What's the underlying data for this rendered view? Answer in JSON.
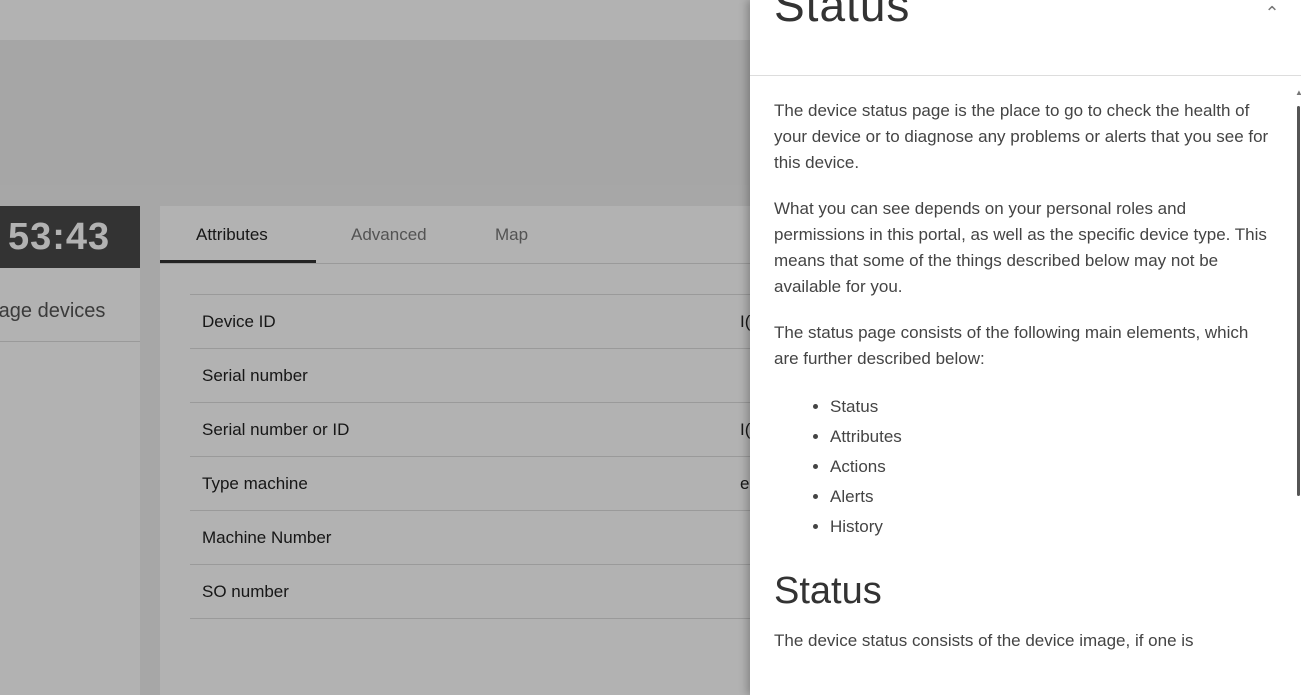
{
  "background": {
    "timer": "53:43",
    "left_link": "rage devices",
    "tabs": [
      {
        "label": "Attributes",
        "active": true
      },
      {
        "label": "Advanced",
        "active": false
      },
      {
        "label": "Map",
        "active": false
      }
    ],
    "attributes": [
      {
        "label": "Device ID",
        "value": "I("
      },
      {
        "label": "Serial number",
        "value": ""
      },
      {
        "label": "Serial number or ID",
        "value": "I("
      },
      {
        "label": "Type machine",
        "value": "e"
      },
      {
        "label": "Machine Number",
        "value": ""
      },
      {
        "label": "SO number",
        "value": ""
      }
    ]
  },
  "help": {
    "title": "Status",
    "collapse_icon": "chevron-up-icon",
    "paragraphs": [
      "The device status page is the place to go to check the health of your device or to diagnose any problems or alerts that you see for this device.",
      "What you can see depends on your personal roles and permissions in this portal, as well as the specific device type. This means that some of the things described below may not be available for you.",
      "The status page consists of the following main elements, which are further described below:"
    ],
    "elements": [
      "Status",
      "Attributes",
      "Actions",
      "Alerts",
      "History"
    ],
    "subtitle": "Status",
    "cut_text": "The device status consists of the device image, if one is"
  },
  "colors": {
    "overlay": "#000000",
    "timer_bg": "#4a4a4a",
    "tab_underline": "#333333"
  }
}
